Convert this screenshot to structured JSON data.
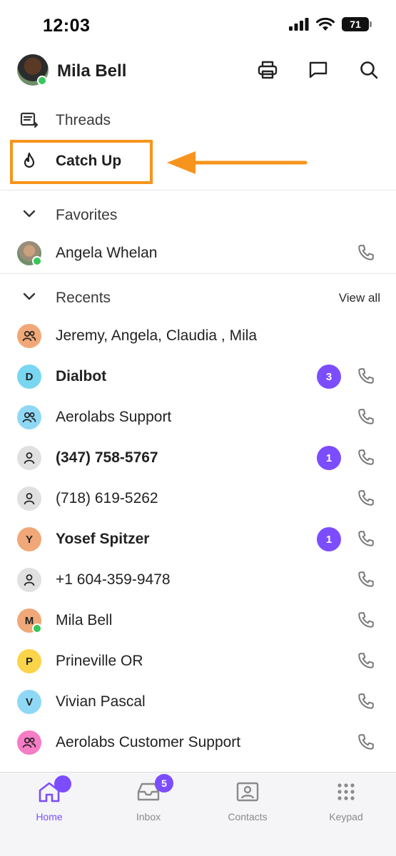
{
  "status_bar": {
    "time": "12:03",
    "battery": "71"
  },
  "header": {
    "user_name": "Mila Bell"
  },
  "nav": {
    "threads_label": "Threads",
    "catch_up_label": "Catch Up"
  },
  "favorites": {
    "title": "Favorites",
    "items": [
      {
        "name": "Angela Whelan"
      }
    ]
  },
  "recents": {
    "title": "Recents",
    "view_all_label": "View all",
    "items": [
      {
        "name": "Jeremy, Angela, Claudia , Mila",
        "avatar_type": "group-icon",
        "avatar_color": "#f0a878"
      },
      {
        "name": "Dialbot",
        "initial": "D",
        "avatar_color": "#79d6f0",
        "unread": "3"
      },
      {
        "name": "Aerolabs Support",
        "avatar_type": "group-icon",
        "avatar_color": "#8fd8f5"
      },
      {
        "name": "(347) 758-5767",
        "avatar_type": "person-icon",
        "avatar_color": "#e0e0e0",
        "unread": "1"
      },
      {
        "name": "(718) 619-5262",
        "avatar_type": "person-icon",
        "avatar_color": "#e0e0e0"
      },
      {
        "name": "Yosef Spitzer",
        "initial": "Y",
        "avatar_color": "#f0a878",
        "unread": "1"
      },
      {
        "name": "+1 604-359-9478",
        "avatar_type": "person-icon",
        "avatar_color": "#e0e0e0"
      },
      {
        "name": "Mila Bell",
        "initial": "M",
        "avatar_color": "#f0a878",
        "online": true
      },
      {
        "name": "Prineville OR",
        "initial": "P",
        "avatar_color": "#fbd44a"
      },
      {
        "name": "Vivian Pascal",
        "initial": "V",
        "avatar_color": "#8fd8f5"
      },
      {
        "name": "Aerolabs Customer Support",
        "avatar_type": "group-icon",
        "avatar_color": "#f57cc5"
      }
    ]
  },
  "tabbar": {
    "home_label": "Home",
    "inbox_label": "Inbox",
    "inbox_badge": "5",
    "contacts_label": "Contacts",
    "keypad_label": "Keypad"
  },
  "colors": {
    "accent": "#7c4dff",
    "highlight": "#f7941d",
    "online": "#34c759"
  }
}
